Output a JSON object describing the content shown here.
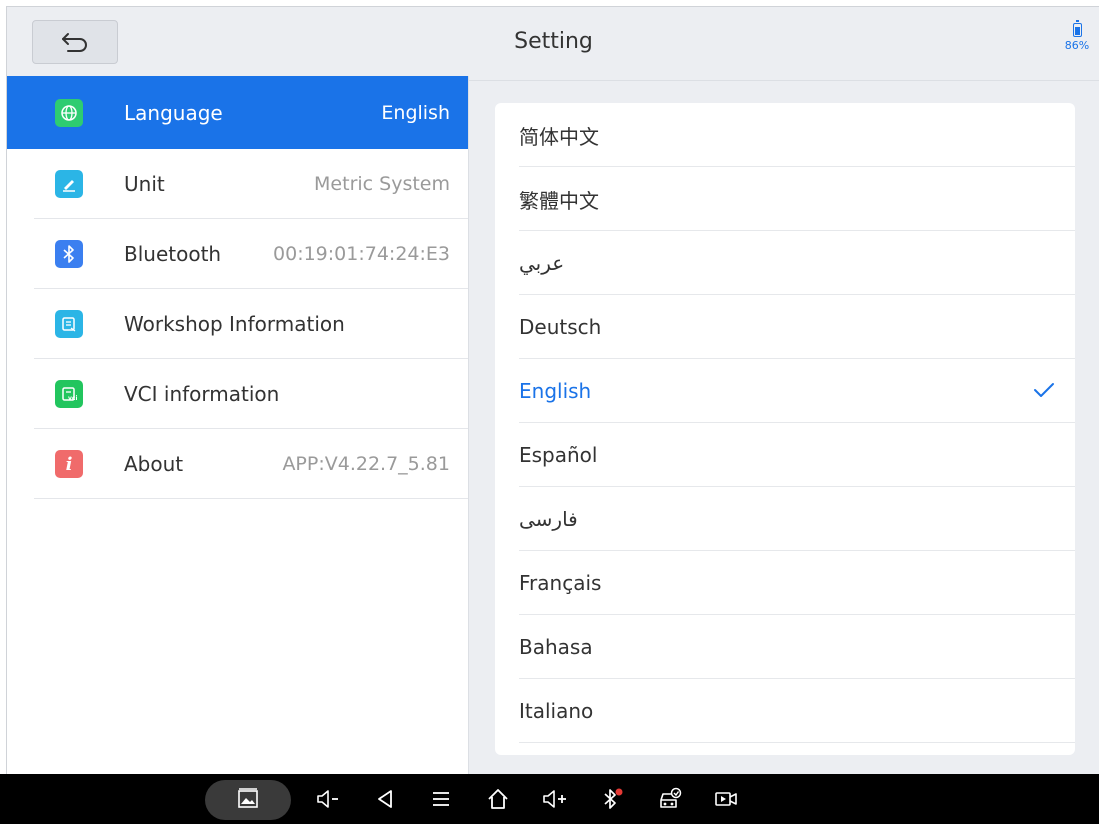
{
  "header": {
    "title": "Setting",
    "battery_percent": "86%",
    "battery_level": 0.86
  },
  "sidebar": {
    "items": [
      {
        "label": "Language",
        "value": "English",
        "icon": "globe-icon",
        "color": "#2ecc71",
        "active": true
      },
      {
        "label": "Unit",
        "value": "Metric System",
        "icon": "ruler-pen-icon",
        "color": "#2bb5e6",
        "active": false
      },
      {
        "label": "Bluetooth",
        "value": "00:19:01:74:24:E3",
        "icon": "bluetooth-icon",
        "color": "#3b7ff0",
        "active": false
      },
      {
        "label": "Workshop Information",
        "value": "",
        "icon": "workshop-doc-icon",
        "color": "#2bb5e6",
        "active": false
      },
      {
        "label": "VCI information",
        "value": "",
        "icon": "vci-doc-icon",
        "color": "#22c55e",
        "active": false
      },
      {
        "label": "About",
        "value": "APP:V4.22.7_5.81",
        "icon": "info-icon",
        "color": "#f06b6b",
        "active": false
      }
    ]
  },
  "languages": {
    "items": [
      "简体中文",
      "繁體中文",
      "عربي",
      "Deutsch",
      "English",
      "Español",
      "فارسی",
      "Français",
      "Bahasa",
      "Italiano"
    ],
    "selected": "English"
  },
  "colors": {
    "accent": "#1a73e8",
    "navbar": "#000000"
  },
  "navbar": {
    "icons": [
      "gallery-icon",
      "volume-down-icon",
      "back-triangle-icon",
      "menu-icon",
      "home-icon",
      "volume-up-icon",
      "bluetooth-off-icon",
      "car-diagnostic-icon",
      "screen-record-icon"
    ]
  }
}
